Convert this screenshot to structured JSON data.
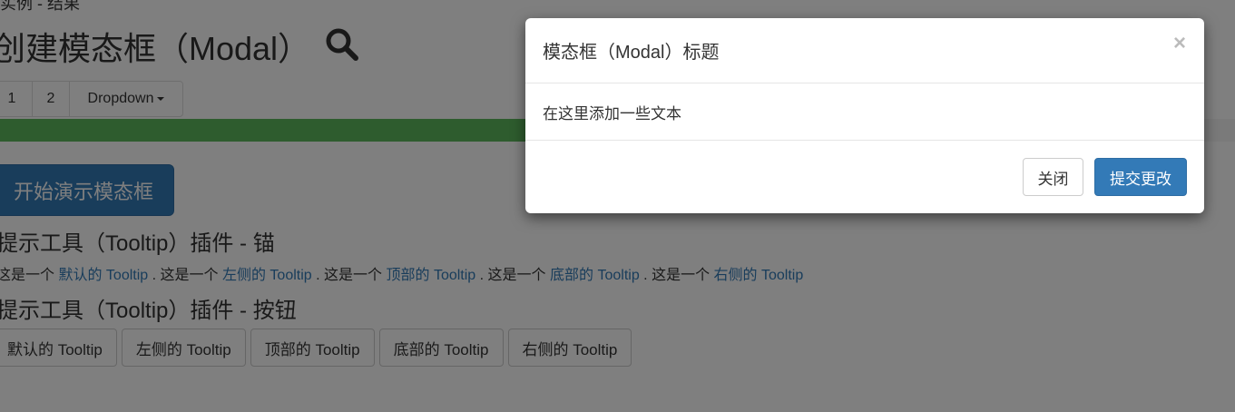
{
  "page": {
    "top_text": "实例 - 结果",
    "title": "创建模态框（Modal）",
    "search_icon": "search-icon"
  },
  "pager": {
    "items": [
      "1",
      "2"
    ],
    "dropdown_label": "Dropdown"
  },
  "progress": {
    "value_fraction": 0.43,
    "color": "#5cb85c"
  },
  "demo_button": {
    "label": "开始演示模态框",
    "color": "#337ab7"
  },
  "tooltip_anchor_section": {
    "heading": "提示工具（Tooltip）插件 - 锚",
    "prefix": "这是一个",
    "links": [
      "默认的 Tooltip",
      "左侧的 Tooltip",
      "顶部的 Tooltip",
      "底部的 Tooltip",
      "右侧的 Tooltip"
    ]
  },
  "tooltip_button_section": {
    "heading": "提示工具（Tooltip）插件 - 按钮",
    "buttons": [
      "默认的 Tooltip",
      "左侧的 Tooltip",
      "顶部的 Tooltip",
      "底部的 Tooltip",
      "右侧的 Tooltip"
    ]
  },
  "modal": {
    "title": "模态框（Modal）标题",
    "close_symbol": "×",
    "body": "在这里添加一些文本",
    "close_button": "关闭",
    "submit_button": "提交更改"
  }
}
